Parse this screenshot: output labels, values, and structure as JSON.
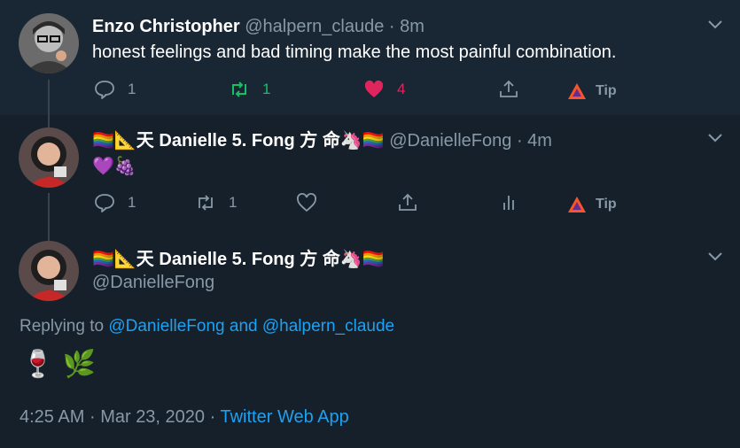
{
  "tweets": [
    {
      "name": "Enzo Christopher",
      "handle": "@halpern_claude",
      "sep": "·",
      "time": "8m",
      "text": "honest feelings and bad timing make the most painful combination.",
      "reply_count": "1",
      "retweet_count": "1",
      "like_count": "4",
      "tip_label": "Tip"
    },
    {
      "name_prefix": "🏳️‍🌈📐天",
      "name": "Danielle 5. Fong 方 命🦄🏳️‍🌈",
      "handle": "@DanielleFong",
      "sep": "·",
      "time": "4m",
      "text": "💜🍇",
      "reply_count": "1",
      "retweet_count": "1",
      "tip_label": "Tip"
    }
  ],
  "main_tweet": {
    "name_prefix": "🏳️‍🌈📐天",
    "name": "Danielle 5. Fong 方 命🦄🏳️‍🌈",
    "handle": "@DanielleFong",
    "replying_prefix": "Replying to",
    "replying_user1": "@DanielleFong",
    "replying_and": "and",
    "replying_user2": "@halpern_claude",
    "text": "🍷 🌿",
    "time": "4:25 AM",
    "sep1": "·",
    "date": "Mar 23, 2020",
    "sep2": "·",
    "source": "Twitter Web App"
  },
  "colors": {
    "background": "#15202b",
    "highlight_bg": "#192734",
    "muted": "#8899a6",
    "link": "#1da1f2",
    "retweet_green": "#17bf63",
    "like_red": "#e0245e"
  },
  "icons": [
    "reply-icon",
    "retweet-icon",
    "like-icon",
    "share-icon",
    "analytics-icon",
    "tip-icon",
    "caret-down-icon"
  ]
}
